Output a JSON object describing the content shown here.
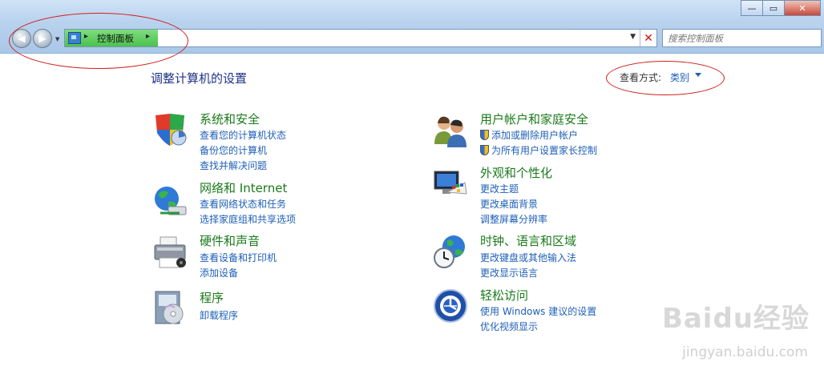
{
  "window": {
    "minimize": "—",
    "maximize": "▭",
    "close": "✕"
  },
  "nav": {
    "breadcrumb": "控制面板",
    "search_placeholder": "搜索控制面板"
  },
  "header": {
    "title": "调整计算机的设置",
    "view_by_label": "查看方式:",
    "view_by_value": "类别"
  },
  "categories": [
    {
      "icon": "shield-security-icon",
      "title": "系统和安全",
      "links": [
        "查看您的计算机状态",
        "备份您的计算机",
        "查找并解决问题"
      ]
    },
    {
      "icon": "network-globe-icon",
      "title": "网络和 Internet",
      "links": [
        "查看网络状态和任务",
        "选择家庭组和共享选项"
      ]
    },
    {
      "icon": "printer-icon",
      "title": "硬件和声音",
      "links": [
        "查看设备和打印机",
        "添加设备"
      ]
    },
    {
      "icon": "programs-disc-icon",
      "title": "程序",
      "links": [
        "卸载程序"
      ]
    },
    {
      "icon": "users-icon",
      "title": "用户帐户和家庭安全",
      "links": [
        "添加或删除用户帐户",
        "为所有用户设置家长控制"
      ]
    },
    {
      "icon": "monitor-palette-icon",
      "title": "外观和个性化",
      "links": [
        "更改主题",
        "更改桌面背景",
        "调整屏幕分辨率"
      ]
    },
    {
      "icon": "clock-globe-icon",
      "title": "时钟、语言和区域",
      "links": [
        "更改键盘或其他输入法",
        "更改显示语言"
      ]
    },
    {
      "icon": "ease-of-access-icon",
      "title": "轻松访问",
      "links": [
        "使用 Windows 建议的设置",
        "优化视频显示"
      ]
    }
  ],
  "watermark": {
    "brand": "Baidu经验",
    "url": "jingyan.baidu.com"
  }
}
